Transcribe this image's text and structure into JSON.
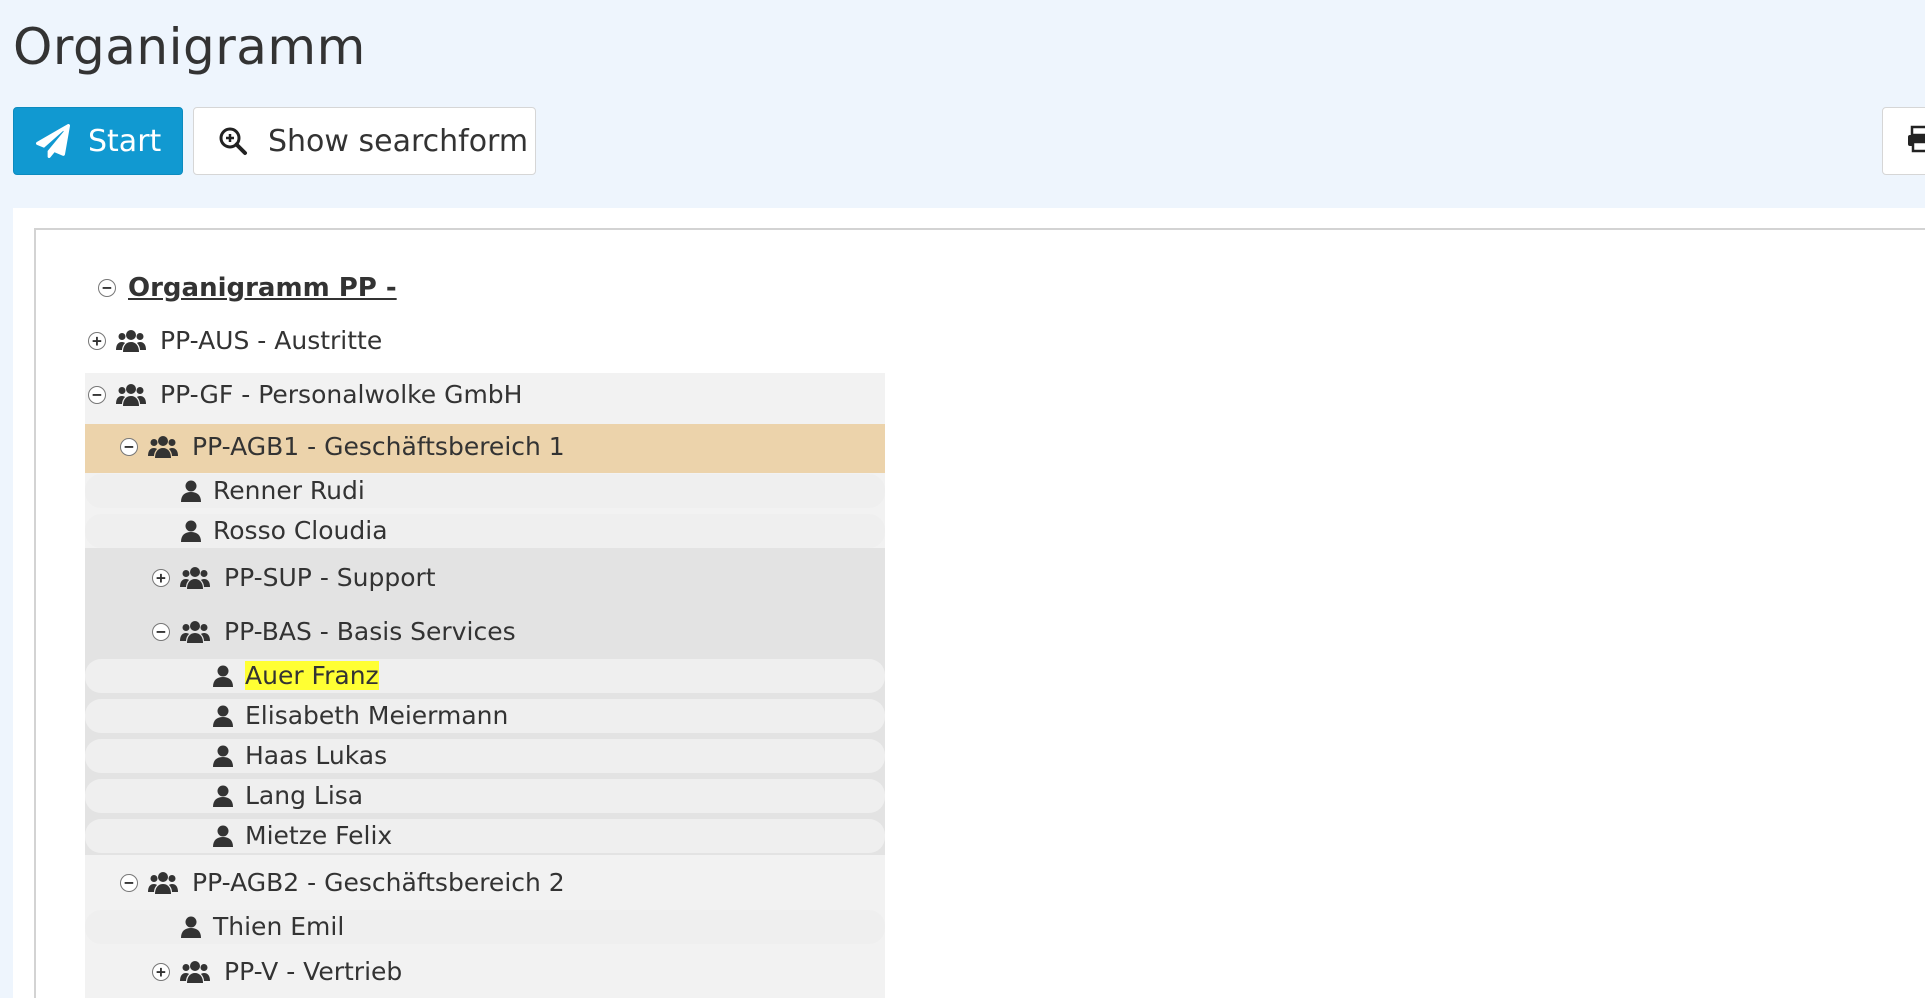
{
  "page": {
    "title": "Organigramm"
  },
  "toolbar": {
    "start_label": "Start",
    "search_label": "Show searchform",
    "print_icon": "print-icon"
  },
  "colors": {
    "start_button": "#1199d1",
    "selected_row": "#ecd3ab",
    "search_highlight": "#ffff33"
  },
  "tree": {
    "root_label": "Organigramm PP -",
    "nodes": {
      "aus": "PP-AUS - Austritte",
      "gf": "PP-GF - Personalwolke GmbH",
      "agb1": "PP-AGB1 - Geschäftsbereich 1",
      "renner": "Renner Rudi",
      "rosso": "Rosso Cloudia",
      "sup": "PP-SUP - Support",
      "bas": "PP-BAS - Basis Services",
      "auer": "Auer Franz",
      "meiermann": "Elisabeth Meiermann",
      "haas": "Haas Lukas",
      "lang": "Lang Lisa",
      "mietze": "Mietze Felix",
      "agb2": "PP-AGB2 - Geschäftsbereich 2",
      "thien": "Thien Emil",
      "vertrieb": "PP-V - Vertrieb"
    }
  }
}
